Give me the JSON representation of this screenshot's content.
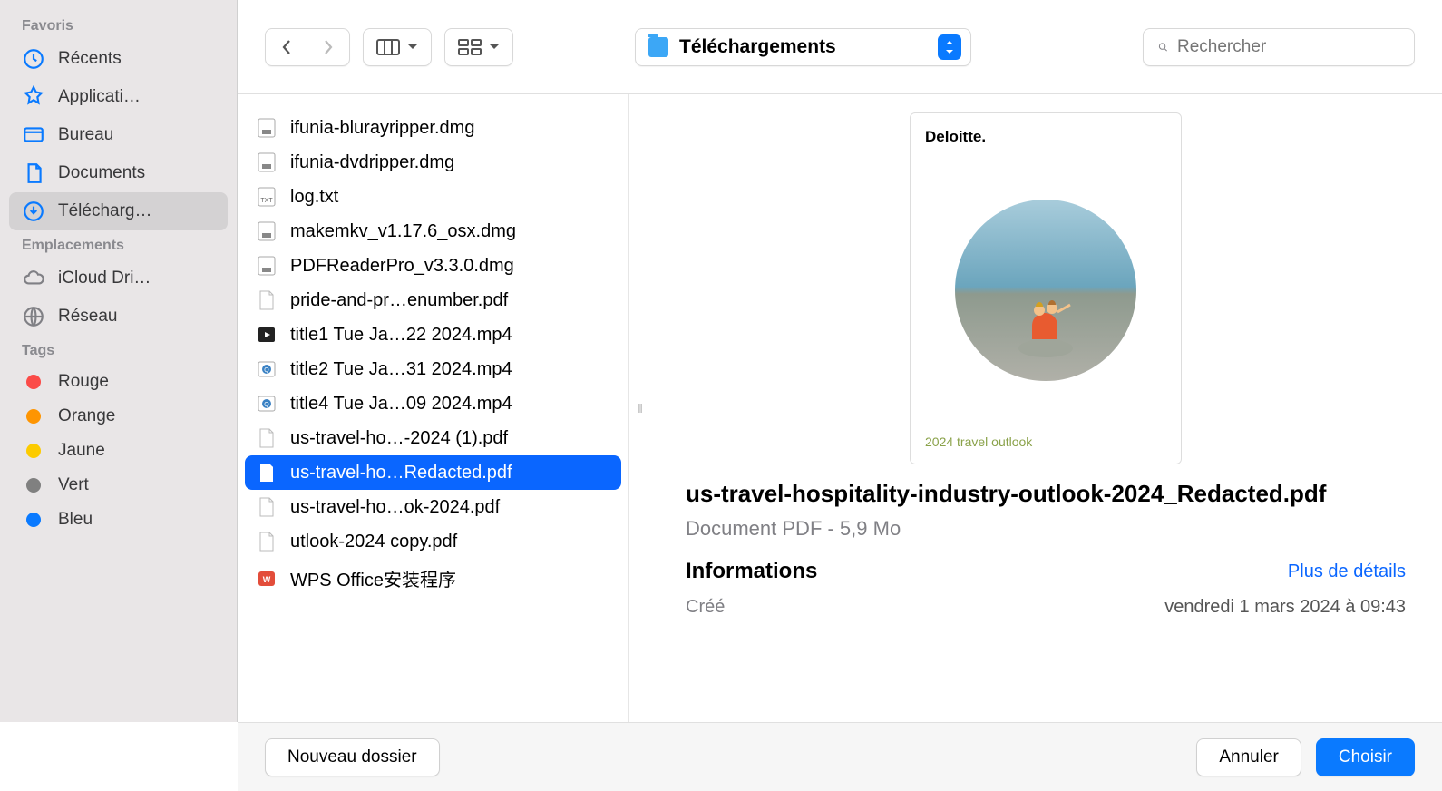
{
  "sidebar": {
    "sections": [
      {
        "header": "Favoris",
        "items": [
          {
            "label": "Récents",
            "icon": "clock"
          },
          {
            "label": "Applicati…",
            "icon": "apps"
          },
          {
            "label": "Bureau",
            "icon": "desktop"
          },
          {
            "label": "Documents",
            "icon": "document"
          },
          {
            "label": "Télécharg…",
            "icon": "download",
            "selected": true
          }
        ]
      },
      {
        "header": "Emplacements",
        "items": [
          {
            "label": "iCloud Dri…",
            "icon": "cloud"
          },
          {
            "label": "Réseau",
            "icon": "globe"
          }
        ]
      },
      {
        "header": "Tags",
        "items": [
          {
            "label": "Rouge",
            "color": "#fb4b48"
          },
          {
            "label": "Orange",
            "color": "#fe9502"
          },
          {
            "label": "Jaune",
            "color": "#fccb00"
          },
          {
            "label": "Vert",
            "color": "#808080"
          },
          {
            "label": "Bleu",
            "color": "#0a7aff"
          }
        ]
      }
    ]
  },
  "toolbar": {
    "location": "Téléchargements",
    "search_placeholder": "Rechercher"
  },
  "files": [
    {
      "name": "ifunia-blurayripper.dmg",
      "icon": "dmg"
    },
    {
      "name": "ifunia-dvdripper.dmg",
      "icon": "dmg"
    },
    {
      "name": "log.txt",
      "icon": "txt"
    },
    {
      "name": "makemkv_v1.17.6_osx.dmg",
      "icon": "dmg"
    },
    {
      "name": "PDFReaderPro_v3.3.0.dmg",
      "icon": "dmg"
    },
    {
      "name": "pride-and-pr…enumber.pdf",
      "icon": "pdf"
    },
    {
      "name": "title1 Tue Ja…22 2024.mp4",
      "icon": "mp4"
    },
    {
      "name": "title2 Tue Ja…31 2024.mp4",
      "icon": "qt"
    },
    {
      "name": "title4 Tue Ja…09 2024.mp4",
      "icon": "qt"
    },
    {
      "name": "us-travel-ho…-2024 (1).pdf",
      "icon": "pdf"
    },
    {
      "name": "us-travel-ho…Redacted.pdf",
      "icon": "pdf",
      "selected": true
    },
    {
      "name": "us-travel-ho…ok-2024.pdf",
      "icon": "pdf"
    },
    {
      "name": "utlook-2024 copy.pdf",
      "icon": "pdf"
    },
    {
      "name": "WPS Office安装程序",
      "icon": "wps"
    }
  ],
  "preview": {
    "brand": "Deloitte.",
    "caption": "2024 travel outlook",
    "filename": "us-travel-hospitality-industry-outlook-2024_Redacted.pdf",
    "meta": "Document PDF - 5,9 Mo",
    "info_header": "Informations",
    "details_link": "Plus de détails",
    "created_label": "Créé",
    "created_value": "vendredi 1 mars 2024 à 09:43"
  },
  "footer": {
    "new_folder": "Nouveau dossier",
    "cancel": "Annuler",
    "choose": "Choisir"
  }
}
